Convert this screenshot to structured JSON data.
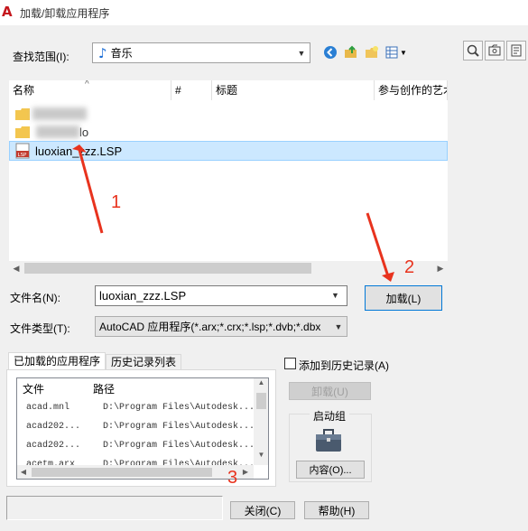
{
  "window": {
    "title": "加载/卸载应用程序"
  },
  "lookin": {
    "label": "查找范围(I):",
    "value": "音乐"
  },
  "toolbar": {
    "icons": [
      "back-icon",
      "up-folder-icon",
      "new-folder-icon",
      "view-menu-icon",
      "search-web-icon",
      "find-icon",
      "options-icon"
    ]
  },
  "filelist": {
    "columns": [
      "名称",
      "#",
      "标题",
      "参与创作的艺术家"
    ],
    "items": [
      {
        "name": "",
        "icon": "folder-icon",
        "blurred": true
      },
      {
        "name": "lo",
        "icon": "folder-icon",
        "blurred": true
      },
      {
        "name": "luoxian_zzz.LSP",
        "icon": "lsp-file-icon",
        "selected": true
      }
    ]
  },
  "form": {
    "filename_label": "文件名(N):",
    "filename_value": "luoxian_zzz.LSP",
    "filetype_label": "文件类型(T):",
    "filetype_value": "AutoCAD 应用程序(*.arx;*.crx;*.lsp;*.dvb;*.dbx",
    "load_button": "加载(L)"
  },
  "tabs": [
    {
      "label": "已加载的应用程序",
      "active": true
    },
    {
      "label": "历史记录列表",
      "active": false
    }
  ],
  "app_table": {
    "headers": [
      "文件",
      "路径"
    ],
    "rows": [
      {
        "file": "acad.mnl",
        "path": "D:\\Program Files\\Autodesk..."
      },
      {
        "file": "acad202...",
        "path": "D:\\Program Files\\Autodesk..."
      },
      {
        "file": "acad202...",
        "path": "D:\\Program Files\\Autodesk..."
      },
      {
        "file": "acetm.arx",
        "path": "D:\\Program Files\\Autodesk..."
      }
    ]
  },
  "right_panel": {
    "history_checkbox": "添加到历史记录(A)",
    "unload_button": "卸载(U)",
    "startup_group": "启动组",
    "contents_button": "内容(O)..."
  },
  "bottom": {
    "close_button": "关闭(C)",
    "help_button": "帮助(H)"
  },
  "annotations": [
    "1",
    "2",
    "3"
  ],
  "colors": {
    "annotation": "#e8331e",
    "selection": "#cce8ff",
    "logo": "#c4161c"
  }
}
